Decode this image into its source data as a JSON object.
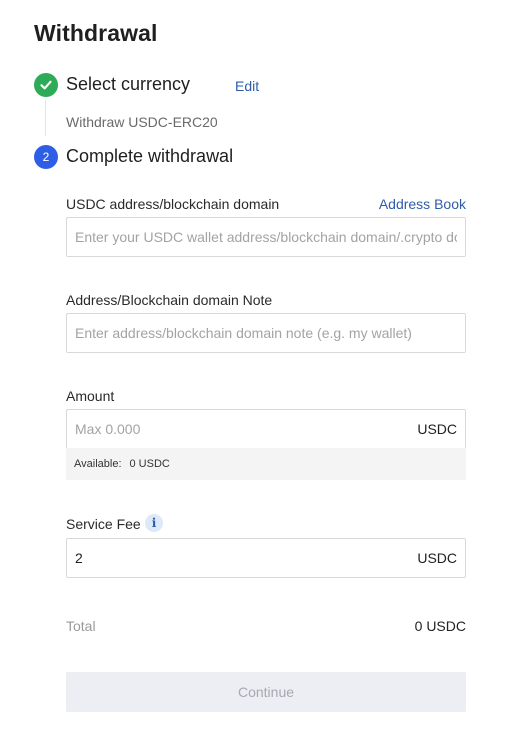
{
  "page": {
    "title": "Withdrawal"
  },
  "steps": [
    {
      "label": "Select currency",
      "edit_label": "Edit",
      "summary": "Withdraw USDC-ERC20",
      "icon": "check-icon",
      "status": "done"
    },
    {
      "number": "2",
      "label": "Complete withdrawal",
      "status": "active"
    }
  ],
  "form": {
    "address": {
      "label": "USDC address/blockchain domain",
      "link_label": "Address Book",
      "placeholder": "Enter your USDC wallet address/blockchain domain/.crypto domain",
      "value": ""
    },
    "note": {
      "label": "Address/Blockchain domain Note",
      "placeholder": "Enter address/blockchain domain note (e.g. my wallet)",
      "value": ""
    },
    "amount": {
      "label": "Amount",
      "placeholder": "Max 0.000",
      "value": "",
      "unit": "USDC",
      "available_label": "Available:",
      "available_value": "0 USDC"
    },
    "service_fee": {
      "label": "Service Fee",
      "icon": "info-icon",
      "value": "2",
      "unit": "USDC"
    },
    "total": {
      "label": "Total",
      "value": "0 USDC"
    },
    "continue_label": "Continue"
  },
  "colors": {
    "success": "#2eab57",
    "accent": "#2f5ee6",
    "link": "#2f5ca8",
    "disabled_button_bg": "#eceef3",
    "disabled_button_text": "#a6a9b2"
  }
}
